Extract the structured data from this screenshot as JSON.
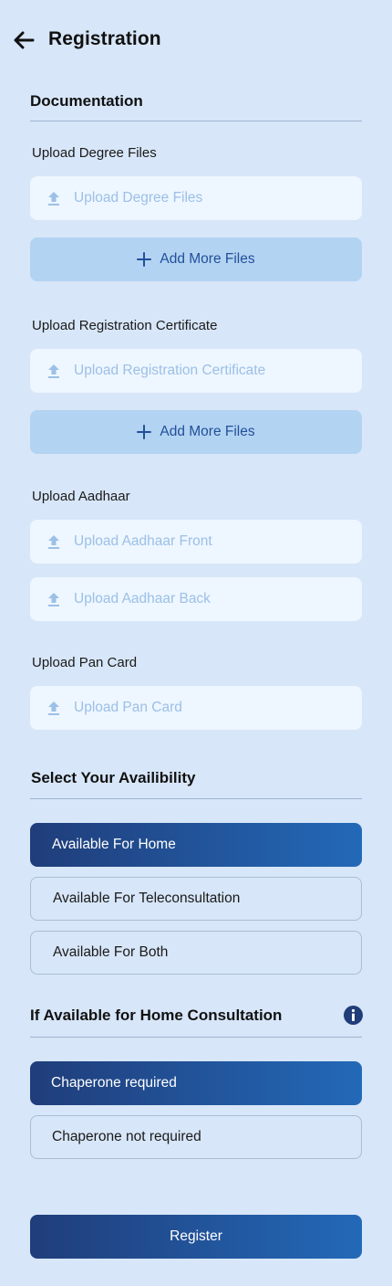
{
  "header": {
    "title": "Registration"
  },
  "documentation": {
    "title": "Documentation",
    "degree": {
      "label": "Upload Degree Files",
      "placeholder": "Upload Degree Files",
      "add_more": "Add More Files"
    },
    "registration": {
      "label": "Upload Registration Certificate",
      "placeholder": "Upload Registration Certificate",
      "add_more": "Add More Files"
    },
    "aadhaar": {
      "label": "Upload Aadhaar",
      "front_placeholder": "Upload Aadhaar Front",
      "back_placeholder": "Upload Aadhaar Back"
    },
    "pan": {
      "label": "Upload Pan Card",
      "placeholder": "Upload Pan Card"
    }
  },
  "availability": {
    "title": "Select Your Availibility",
    "options": [
      "Available For Home",
      "Available For Teleconsultation",
      "Available For Both"
    ],
    "selected": "Available For Home"
  },
  "home_consultation": {
    "title": "If Available for Home Consultation",
    "options": [
      "Chaperone required",
      "Chaperone not required"
    ],
    "selected": "Chaperone required"
  },
  "register_label": "Register",
  "colors": {
    "background": "#d7e6f8",
    "accent_start": "#203d7a",
    "accent_end": "#2369b8",
    "placeholder": "#9cc0e6",
    "add_more_bg": "#b3d3f2"
  }
}
